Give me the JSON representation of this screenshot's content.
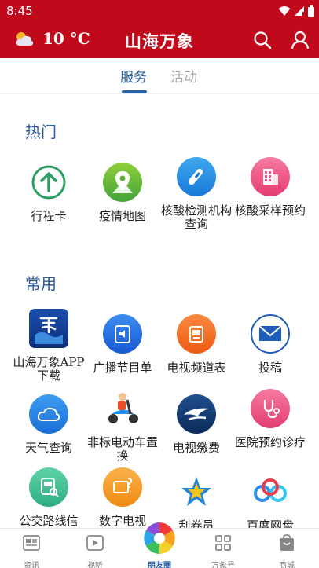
{
  "status_bar": {
    "time": "8:45"
  },
  "header": {
    "temperature": "10 °C",
    "title": "山海万象",
    "weather_icon": "partly-cloudy-icon",
    "search_icon": "search-icon",
    "profile_icon": "user-icon"
  },
  "tabs": [
    {
      "label": "服务",
      "active": true
    },
    {
      "label": "活动",
      "active": false
    }
  ],
  "sections": {
    "hot": {
      "title": "热门",
      "items": [
        {
          "label": "行程卡",
          "icon": "arrow-up-circle-icon"
        },
        {
          "label": "疫情地图",
          "icon": "map-pin-icon"
        },
        {
          "label": "核酸检测机构查询",
          "icon": "test-tube-icon"
        },
        {
          "label": "核酸采样预约",
          "icon": "building-icon"
        }
      ]
    },
    "common": {
      "title": "常用",
      "items": [
        {
          "label": "山海万象APP下载",
          "icon": "app-logo-icon"
        },
        {
          "label": "广播节目单",
          "icon": "speaker-icon"
        },
        {
          "label": "电视频道表",
          "icon": "tv-icon"
        },
        {
          "label": "投稿",
          "icon": "mail-icon"
        },
        {
          "label": "天气查询",
          "icon": "cloud-icon"
        },
        {
          "label": "非标电动车置换",
          "icon": "scooter-icon"
        },
        {
          "label": "电视缴费",
          "icon": "bird-logo-icon"
        },
        {
          "label": "医院预约诊疗",
          "icon": "stethoscope-icon"
        },
        {
          "label": "公交路线信",
          "icon": "bus-icon"
        },
        {
          "label": "数字电视",
          "icon": "tv-question-icon"
        },
        {
          "label": "刮卷员",
          "icon": "star-icon"
        },
        {
          "label": "百度网盘",
          "icon": "cloud-link-icon"
        }
      ]
    }
  },
  "bottom_nav": [
    {
      "label": "资讯",
      "icon": "news-icon"
    },
    {
      "label": "视听",
      "icon": "play-icon"
    },
    {
      "label": "朋友圈",
      "icon": "aperture-icon"
    },
    {
      "label": "万象号",
      "icon": "grid-icon"
    },
    {
      "label": "商城",
      "icon": "bag-icon"
    }
  ],
  "colors": {
    "brand_red": "#c0091b",
    "accent_blue": "#2a63a8"
  }
}
